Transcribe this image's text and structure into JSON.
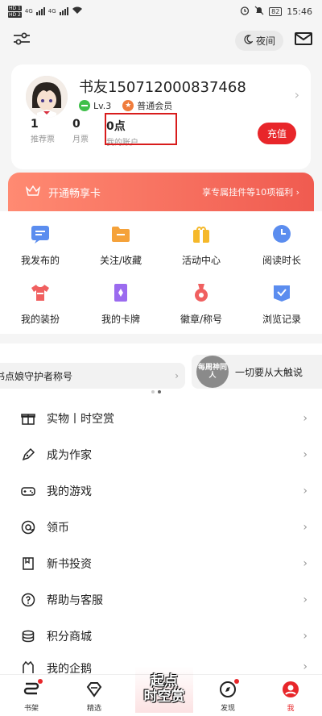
{
  "status_bar": {
    "sim1": "HD 1",
    "sim2": "HD 2",
    "net1": "4G",
    "net2": "4G",
    "battery": "82",
    "time": "15:46"
  },
  "top_bar": {
    "night_label": "夜间"
  },
  "profile": {
    "username": "书友150712000837468",
    "level": "Lv.3",
    "member": "普通会员",
    "stats": [
      {
        "value": "1",
        "label": "推荐票"
      },
      {
        "value": "0",
        "label": "月票"
      },
      {
        "value": "0点",
        "label": "我的账户"
      }
    ],
    "recharge_label": "充值"
  },
  "vip_banner": {
    "title": "开通畅享卡",
    "subtitle": "享专属挂件等10项福利"
  },
  "grid": [
    {
      "label": "我发布的",
      "icon": "post-icon",
      "color": "#5b8def"
    },
    {
      "label": "关注/收藏",
      "icon": "folder-icon",
      "color": "#f5a23a"
    },
    {
      "label": "活动中心",
      "icon": "gift-box-icon",
      "color": "#f5b82a"
    },
    {
      "label": "阅读时长",
      "icon": "clock-icon",
      "color": "#5b8def"
    },
    {
      "label": "我的装扮",
      "icon": "tshirt-icon",
      "color": "#f06060"
    },
    {
      "label": "我的卡牌",
      "icon": "card-icon",
      "color": "#9b6bef"
    },
    {
      "label": "徽章/称号",
      "icon": "medal-icon",
      "color": "#f06060"
    },
    {
      "label": "浏览记录",
      "icon": "history-icon",
      "color": "#5b8def"
    }
  ],
  "carousel": {
    "left_text": "书点娘守护者称号",
    "right_badge": "每周神同人",
    "right_text": "一切要从大触说"
  },
  "list": [
    {
      "label": "实物丨时空赏",
      "icon": "gift-icon"
    },
    {
      "label": "成为作家",
      "icon": "pen-icon"
    },
    {
      "label": "我的游戏",
      "icon": "gamepad-icon"
    },
    {
      "label": "领币",
      "icon": "at-coin-icon"
    },
    {
      "label": "新书投资",
      "icon": "book-invest-icon"
    },
    {
      "label": "帮助与客服",
      "icon": "help-icon"
    },
    {
      "label": "积分商城",
      "icon": "points-icon"
    },
    {
      "label": "我的企鹅",
      "icon": "penguin-icon"
    }
  ],
  "bottom_nav": {
    "items": [
      {
        "label": "书架",
        "icon": "bookshelf-icon"
      },
      {
        "label": "精选",
        "icon": "diamond-icon"
      },
      {
        "label": "发现",
        "icon": "compass-icon"
      },
      {
        "label": "我",
        "icon": "profile-icon"
      }
    ],
    "promo_line1": "起点",
    "promo_line2": "时空赏"
  },
  "colors": {
    "accent": "#e8262a",
    "highlight": "#d81c1c"
  }
}
